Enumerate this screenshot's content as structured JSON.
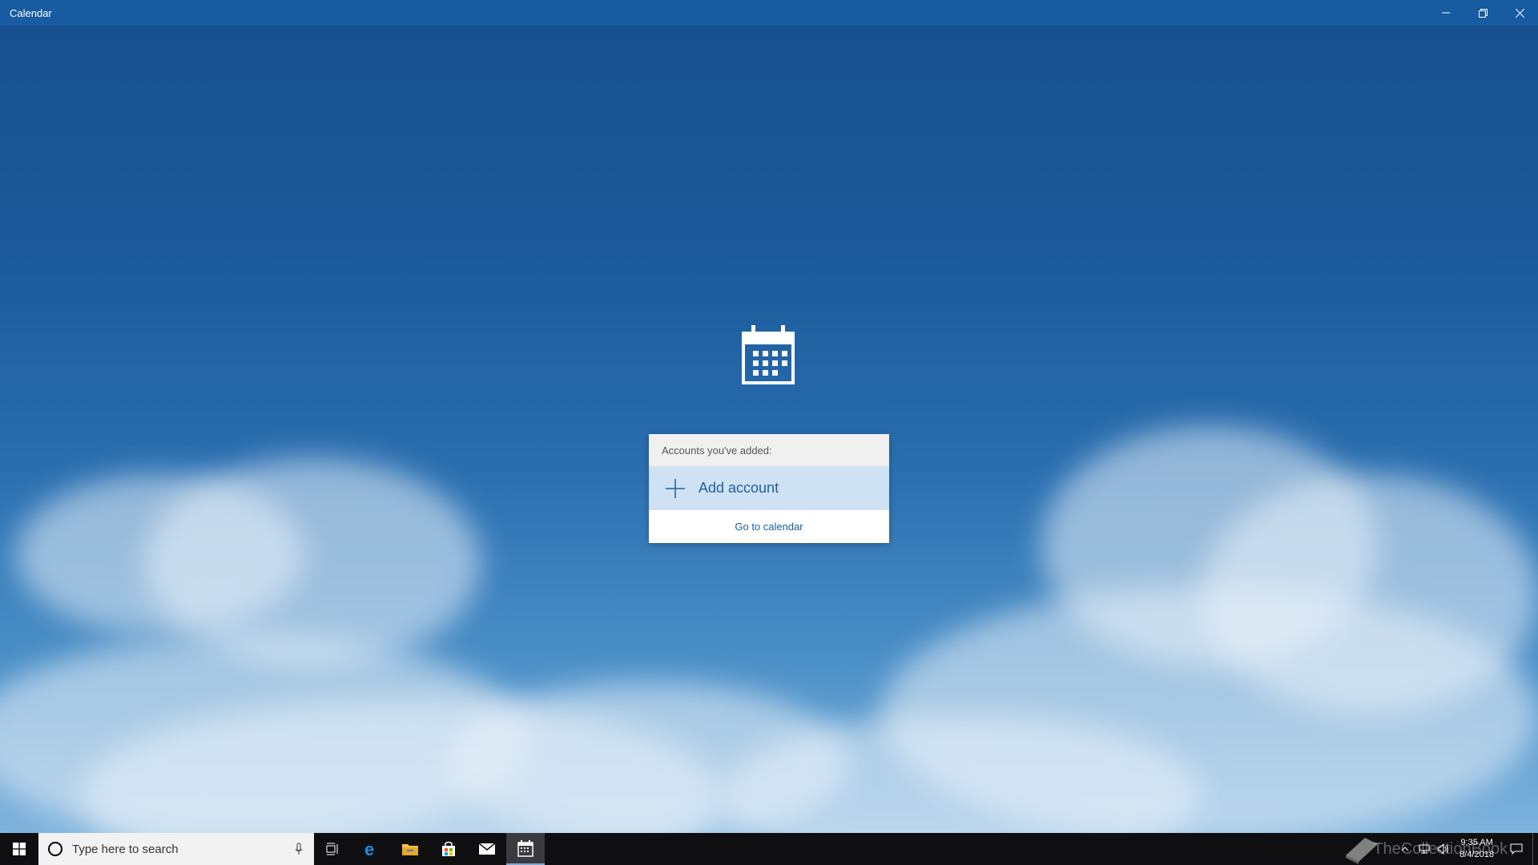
{
  "window": {
    "title": "Calendar",
    "controls": [
      "minimize-icon",
      "restore-icon",
      "close-icon"
    ]
  },
  "background": {
    "description_colors": {
      "sky_top": "#17508f",
      "sky_bottom": "#7eb3dd"
    }
  },
  "accounts_panel": {
    "header": "Accounts you've added:",
    "add_account_label": "Add account",
    "go_to_calendar_label": "Go to calendar"
  },
  "taskbar": {
    "search_placeholder": "Type here to search",
    "pinned_icons": [
      "task-view-icon",
      "edge-icon",
      "file-explorer-icon",
      "store-icon",
      "mail-icon",
      "calendar-icon"
    ],
    "active_app": "calendar-icon",
    "tray": {
      "time": "9:35 AM",
      "date": "8/4/2018"
    },
    "watermark": "TheCollectionBook"
  },
  "colors": {
    "titlebar": "#175ba0",
    "accent": "#1f5e9e",
    "add_account_bg": "#cfe2f3",
    "taskbar": "#0f0f12"
  }
}
